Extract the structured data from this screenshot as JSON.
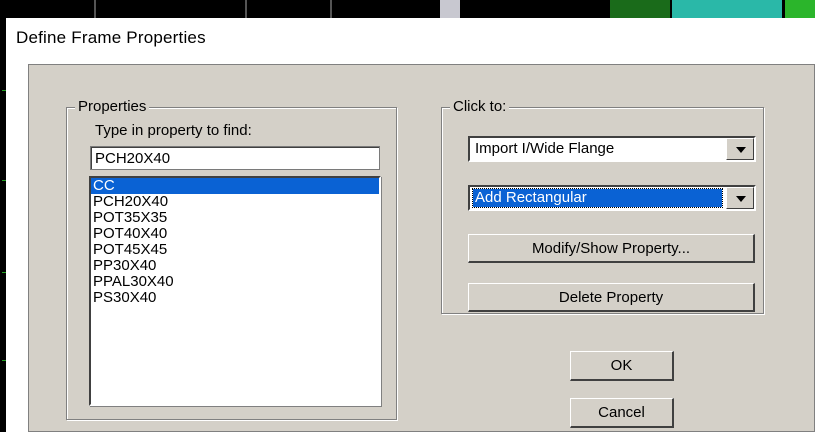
{
  "window": {
    "title": "Define Frame Properties"
  },
  "properties_group": {
    "title": "Properties",
    "find_label": "Type in property to find:",
    "find_value": "PCH20X40",
    "items": [
      {
        "label": "CC",
        "selected": true
      },
      {
        "label": "PCH20X40",
        "selected": false
      },
      {
        "label": "POT35X35",
        "selected": false
      },
      {
        "label": "POT40X40",
        "selected": false
      },
      {
        "label": "POT45X45",
        "selected": false
      },
      {
        "label": "PP30X40",
        "selected": false
      },
      {
        "label": "PPAL30X40",
        "selected": false
      },
      {
        "label": "PS30X40",
        "selected": false
      }
    ]
  },
  "click_group": {
    "title": "Click to:",
    "import_dropdown": {
      "value": "Import I/Wide Flange"
    },
    "add_dropdown": {
      "value": "Add Rectangular"
    },
    "modify_button": "Modify/Show Property...",
    "delete_button": "Delete Property"
  },
  "ok_button": "OK",
  "cancel_button": "Cancel",
  "colors": {
    "selection": "#0a62d4",
    "dialog_face": "#d4d0c8",
    "background_app": "#000000"
  }
}
